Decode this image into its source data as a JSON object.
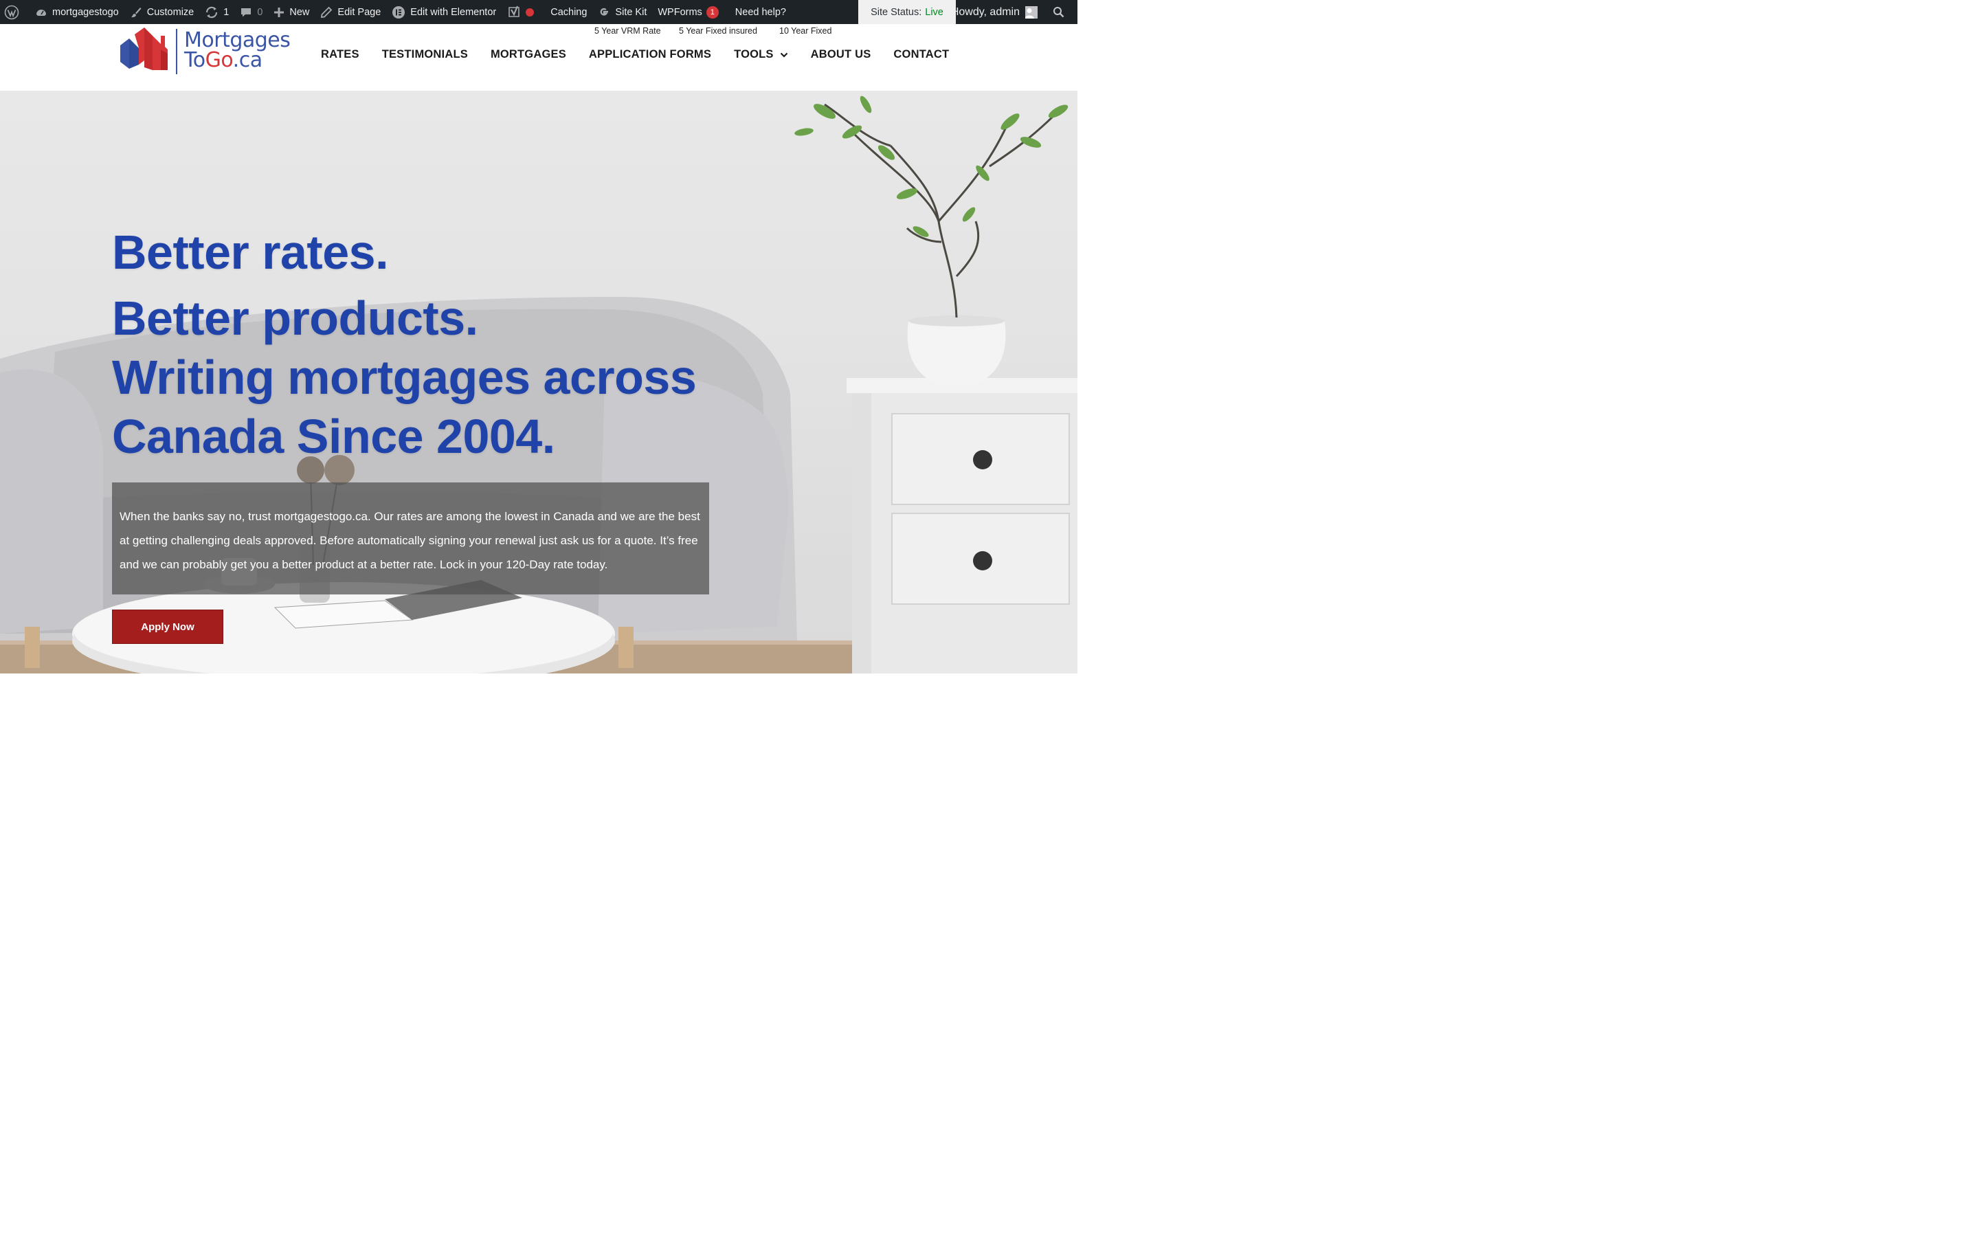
{
  "adminbar": {
    "site_name": "mortgagestogo",
    "customize": "Customize",
    "updates_count": "1",
    "comments_count": "0",
    "new": "New",
    "edit_page": "Edit Page",
    "edit_elementor": "Edit with Elementor",
    "caching": "Caching",
    "site_kit": "Site Kit",
    "wpforms": "WPForms",
    "wpforms_badge": "1",
    "need_help": "Need help?",
    "site_status_label": "Site Status:",
    "site_status_value": "Live",
    "howdy": "Howdy, admin"
  },
  "header": {
    "logo_line1": "Mortgages",
    "logo_line2_a": "To",
    "logo_line2_b": "Go",
    "logo_line2_c": ".ca",
    "top_links": [
      "5 Year VRM Rate",
      "5 Year Fixed insured",
      "10 Year Fixed"
    ],
    "nav": [
      "RATES",
      "TESTIMONIALS",
      "MORTGAGES",
      "APPLICATION FORMS",
      "TOOLS",
      "ABOUT US",
      "CONTACT"
    ]
  },
  "hero": {
    "headline": [
      "Better rates.",
      "Better products.",
      "Writing mortgages across",
      "Canada Since 2004."
    ],
    "description": "When the banks say no, trust mortgagestogo.ca. Our rates are among the lowest in Canada and we are the best at getting challenging deals approved. Before automatically signing your renewal just ask us for a quote. It’s free and we can probably get you a better product at a better rate. Lock in your 120-Day rate today.",
    "cta": "Apply Now"
  },
  "colors": {
    "admin_bar": "#1d2327",
    "brand_blue": "#1f43a8",
    "brand_red": "#d63638",
    "cta_red": "#a41e1e"
  }
}
